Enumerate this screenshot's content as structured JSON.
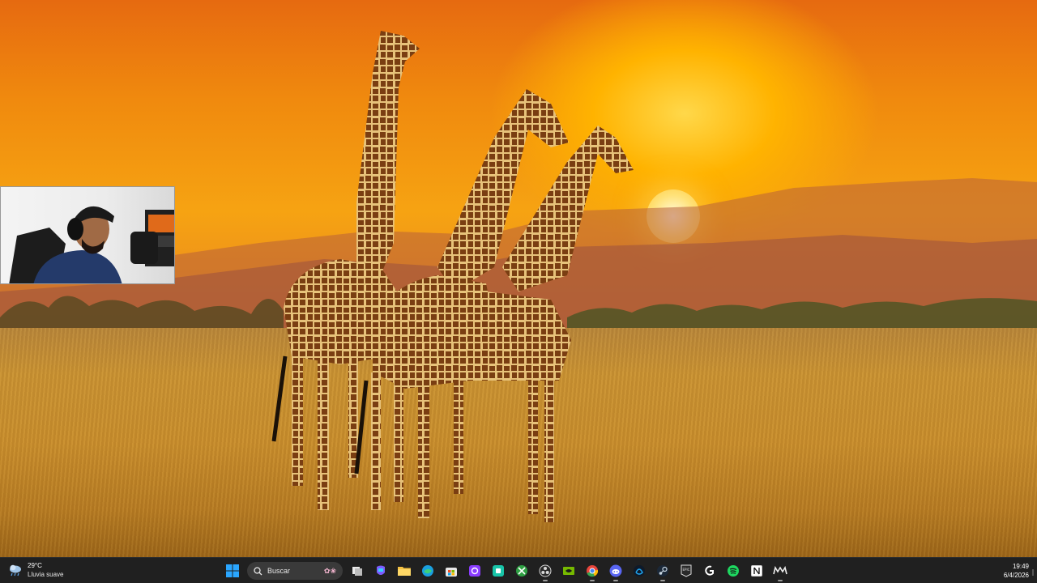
{
  "taskbar": {
    "weather": {
      "temperature": "29°C",
      "condition": "Lluvia suave",
      "icon": "rain-cloud-icon"
    },
    "search": {
      "label": "Buscar",
      "icon": "search-icon"
    },
    "apps": [
      {
        "name": "start-button",
        "icon": "windows-logo-icon",
        "color": "#2aa6ff"
      },
      {
        "name": "task-view-button",
        "icon": "task-view-icon",
        "color": "#d0d0d0"
      },
      {
        "name": "copilot-button",
        "icon": "copilot-icon",
        "color": "#7b5cff"
      },
      {
        "name": "file-explorer-button",
        "icon": "folder-icon",
        "color": "#f5c242"
      },
      {
        "name": "edge-button",
        "icon": "edge-icon",
        "color": "#1aa0e0"
      },
      {
        "name": "store-button",
        "icon": "store-icon",
        "color": "#ffb800"
      },
      {
        "name": "app-purple-button",
        "icon": "camera-app-icon",
        "color": "#8a3cff"
      },
      {
        "name": "app-teal-button",
        "icon": "teal-app-icon",
        "color": "#18c4a8"
      },
      {
        "name": "xbox-button",
        "icon": "xbox-icon",
        "color": "#2ea043"
      },
      {
        "name": "obs-button",
        "icon": "obs-icon",
        "color": "#d8d8d8"
      },
      {
        "name": "nvidia-button",
        "icon": "nvidia-icon",
        "color": "#76b900"
      },
      {
        "name": "chrome-button",
        "icon": "chrome-icon",
        "color": "#e8453c"
      },
      {
        "name": "discord-button",
        "icon": "discord-icon",
        "color": "#5865f2"
      },
      {
        "name": "battlenet-button",
        "icon": "battlenet-icon",
        "color": "#1fa5f0"
      },
      {
        "name": "steam-button",
        "icon": "steam-icon",
        "color": "#c7d5e0"
      },
      {
        "name": "epic-games-button",
        "icon": "epic-games-icon",
        "color": "#e0e0e0"
      },
      {
        "name": "logitech-button",
        "icon": "logitech-icon",
        "color": "#ffffff"
      },
      {
        "name": "spotify-button",
        "icon": "spotify-icon",
        "color": "#1ed760"
      },
      {
        "name": "notion-button",
        "icon": "notion-icon",
        "color": "#ffffff"
      },
      {
        "name": "modern-warfare-button",
        "icon": "mw-icon",
        "color": "#eeeeee"
      }
    ],
    "clock": {
      "time": "19:49",
      "date": "6/4/2026"
    }
  },
  "desktop": {
    "wallpaper": "sunset-giraffes-savanna",
    "sky_color": "#f6a312",
    "grass_color": "#c88d2c"
  },
  "webcam": {
    "visible": true
  }
}
